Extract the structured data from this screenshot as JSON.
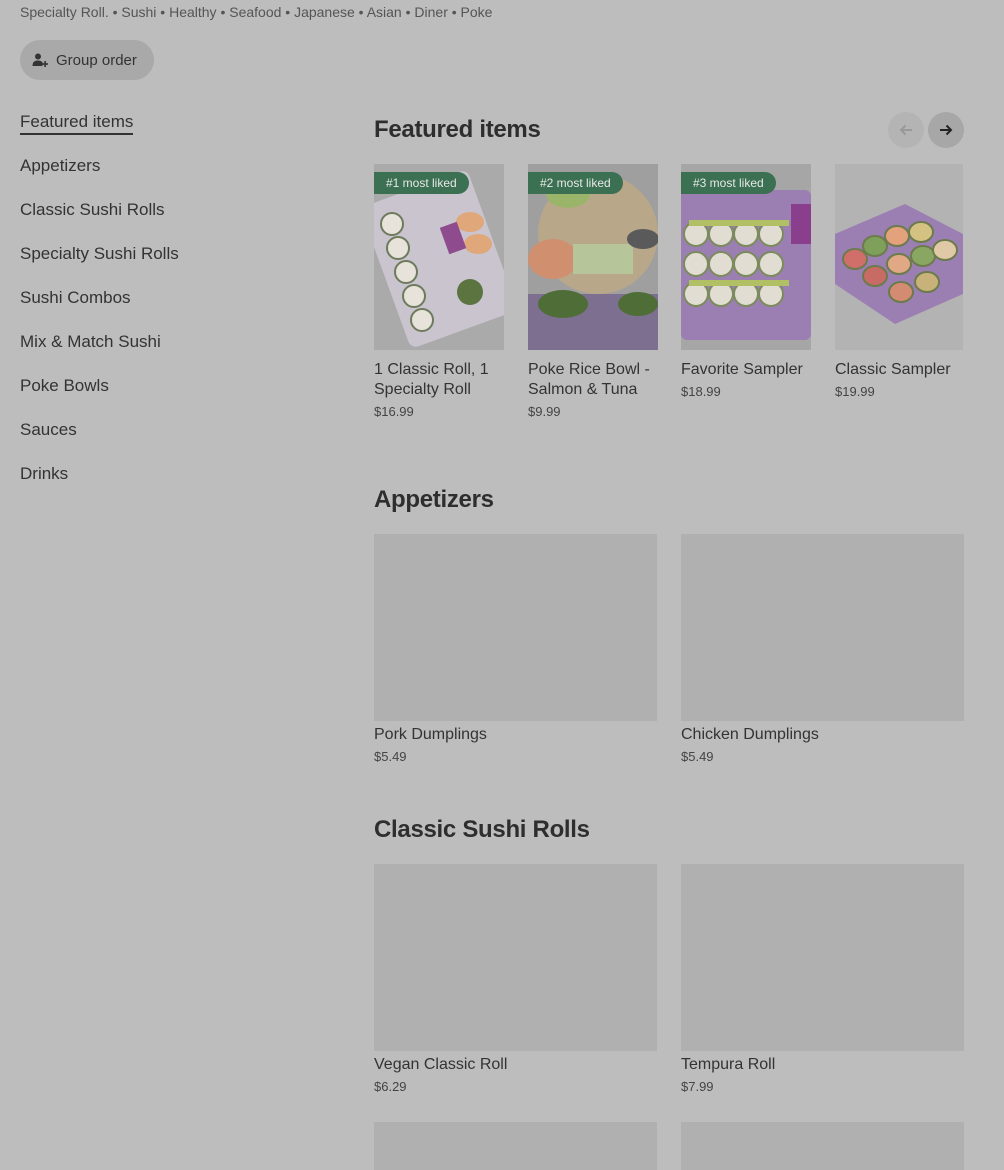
{
  "tags": "Specialty Roll. • Sushi • Healthy • Seafood • Japanese • Asian • Diner • Poke",
  "group_order_label": "Group order",
  "sidebar": {
    "items": [
      {
        "label": "Featured items"
      },
      {
        "label": "Appetizers"
      },
      {
        "label": "Classic Sushi Rolls"
      },
      {
        "label": "Specialty Sushi Rolls"
      },
      {
        "label": "Sushi Combos"
      },
      {
        "label": "Mix & Match Sushi"
      },
      {
        "label": "Poke Bowls"
      },
      {
        "label": "Sauces"
      },
      {
        "label": "Drinks"
      }
    ]
  },
  "featured": {
    "title": "Featured items",
    "items": [
      {
        "badge": "#1 most liked",
        "name": "1 Classic Roll, 1 Specialty Roll",
        "price": "$16.99"
      },
      {
        "badge": "#2 most liked",
        "name": "Poke Rice Bowl - Salmon & Tuna",
        "price": "$9.99"
      },
      {
        "badge": "#3 most liked",
        "name": "Favorite Sampler",
        "price": "$18.99"
      },
      {
        "badge": "",
        "name": "Classic Sampler",
        "price": "$19.99"
      }
    ]
  },
  "appetizers": {
    "title": "Appetizers",
    "items": [
      {
        "name": "Pork Dumplings",
        "price": "$5.49"
      },
      {
        "name": "Chicken Dumplings",
        "price": "$5.49"
      }
    ]
  },
  "classic_rolls": {
    "title": "Classic Sushi Rolls",
    "items": [
      {
        "name": "Vegan Classic Roll",
        "price": "$6.29"
      },
      {
        "name": "Tempura Roll",
        "price": "$7.99"
      }
    ]
  },
  "colors": {
    "overlay_bg": "#bdbdbd",
    "badge_green": "#3b7052",
    "tray_purple": "#9b7fb2"
  }
}
